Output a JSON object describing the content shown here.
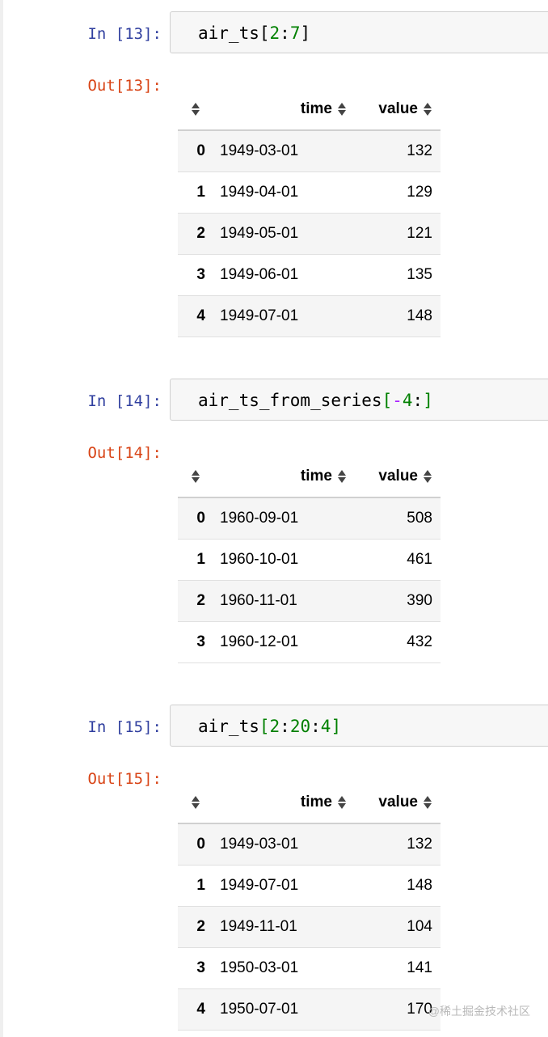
{
  "cells": [
    {
      "in_prompt": "In [13]:",
      "out_prompt": "Out[13]:",
      "code": {
        "name": "air_ts",
        "open": "[",
        "start": "2",
        "sep1": ":",
        "stop": "7",
        "close": "]"
      },
      "columns": [
        "time",
        "value"
      ],
      "rows": [
        {
          "index": "0",
          "time": "1949-03-01",
          "value": "132"
        },
        {
          "index": "1",
          "time": "1949-04-01",
          "value": "129"
        },
        {
          "index": "2",
          "time": "1949-05-01",
          "value": "121"
        },
        {
          "index": "3",
          "time": "1949-06-01",
          "value": "135"
        },
        {
          "index": "4",
          "time": "1949-07-01",
          "value": "148"
        }
      ]
    },
    {
      "in_prompt": "In [14]:",
      "out_prompt": "Out[14]:",
      "code": {
        "name": "air_ts_from_series",
        "open": "[",
        "minus": "-",
        "start": "4",
        "sep1": ":",
        "close": "]"
      },
      "columns": [
        "time",
        "value"
      ],
      "rows": [
        {
          "index": "0",
          "time": "1960-09-01",
          "value": "508"
        },
        {
          "index": "1",
          "time": "1960-10-01",
          "value": "461"
        },
        {
          "index": "2",
          "time": "1960-11-01",
          "value": "390"
        },
        {
          "index": "3",
          "time": "1960-12-01",
          "value": "432"
        }
      ]
    },
    {
      "in_prompt": "In [15]:",
      "out_prompt": "Out[15]:",
      "code": {
        "name": "air_ts",
        "open": "[",
        "start": "2",
        "sep1": ":",
        "stop": "20",
        "sep2": ":",
        "step": "4",
        "close": "]"
      },
      "columns": [
        "time",
        "value"
      ],
      "rows": [
        {
          "index": "0",
          "time": "1949-03-01",
          "value": "132"
        },
        {
          "index": "1",
          "time": "1949-07-01",
          "value": "148"
        },
        {
          "index": "2",
          "time": "1949-11-01",
          "value": "104"
        },
        {
          "index": "3",
          "time": "1950-03-01",
          "value": "141"
        },
        {
          "index": "4",
          "time": "1950-07-01",
          "value": "170"
        }
      ]
    }
  ],
  "watermark": "@稀土掘金技术社区",
  "colors": {
    "in_prompt": "#303f9f",
    "out_prompt": "#d84315",
    "code_number": "#008000",
    "code_operator": "#aa22ff"
  },
  "icons": {
    "sort": "sort-both-icon"
  }
}
